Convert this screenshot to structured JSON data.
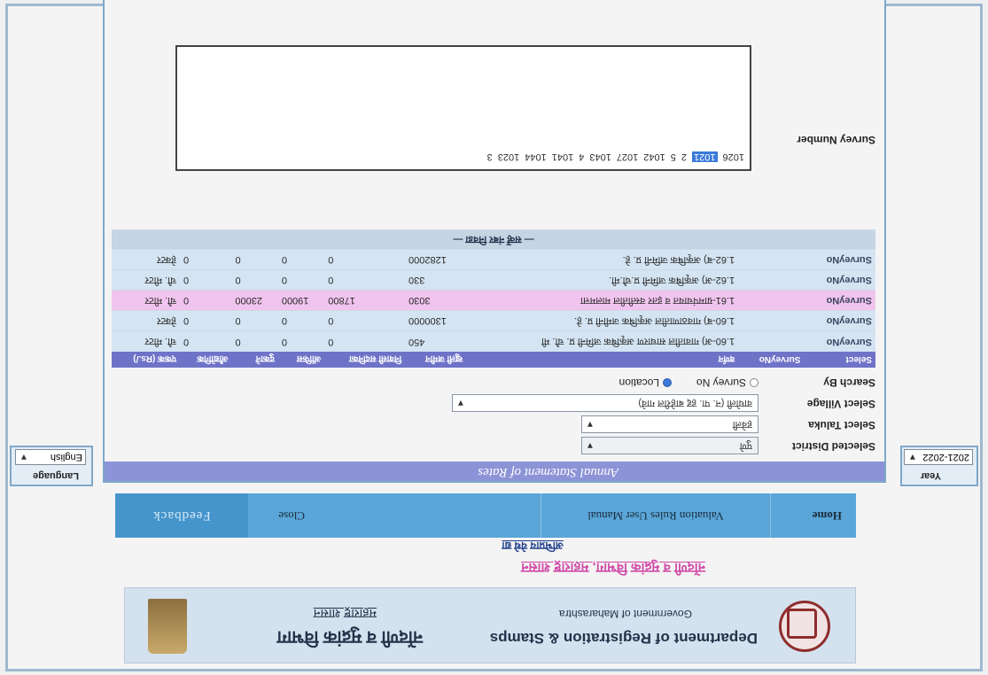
{
  "header": {
    "dept_en": "Department of Registration & Stamps",
    "gov_en": "Government of Maharashtra",
    "dept_mr": "नोंदणी व मुद्रांक विभाग",
    "gov_mr": "महाराष्ट्र शासन",
    "slogan": "नोंदणी व मुद्रांक विभाग, महाराष्ट्र शासन",
    "feedback_link": "अभिप्राय येथे द्या"
  },
  "nav": {
    "home": "Home",
    "valuation": "Valuation Rules   User Manual",
    "close": "Close",
    "feedback": "Feedback"
  },
  "year": {
    "label": "Year",
    "value": "2021-2022"
  },
  "language": {
    "label": "Language",
    "value": "English"
  },
  "panel": {
    "title": "Annual Statement of Rates",
    "district_label": "Selected District",
    "district_value": "पुणे",
    "taluka_label": "Select Taluka",
    "taluka_value": "हवेली",
    "village_label": "Select Village",
    "village_value": "वाघोली (न. पा. हद्द बाहेरील गावे)",
    "search_label": "Search By",
    "search_opt1": "Survey No",
    "search_opt2": "Location"
  },
  "table": {
    "headers": [
      "Select",
      "SurveyNo",
      "वर्णन",
      "खुली जमीन",
      "निवासी सदनिका",
      "ऑफिस",
      "दुकाने",
      "औद्योगिक",
      "एकक (Rs./)"
    ],
    "rows": [
      {
        "sel": "SurveyNo",
        "land": "",
        "desc": "1.60-अ) गावातील साधारण अकृषिक जमिनी प्र. चौ. मी",
        "open": "450",
        "res": "0",
        "off": "0",
        "shop": "0",
        "ind": "0",
        "unit": "चौ. मीटर"
      },
      {
        "sel": "SurveyNo",
        "land": "",
        "desc": "1.60-ब) गावठाणातील अकृषिक जमीनी प्र. हे.",
        "open": "1300000",
        "res": "0",
        "off": "0",
        "shop": "0",
        "ind": "0",
        "unit": "हेक्टर"
      },
      {
        "sel": "SurveyNo",
        "land": "",
        "desc": "1.61-ग्रामपंचायत व इतर वस्तीतील मालमत्ता",
        "open": "3030",
        "res": "17800",
        "off": "19000",
        "shop": "23000",
        "ind": "0",
        "unit": "चौ. मीटर",
        "hl": true
      },
      {
        "sel": "SurveyNo",
        "land": "",
        "desc": "1.62-अ) अकृषिक जमिनी प्र.चौ.मी.",
        "open": "330",
        "res": "0",
        "off": "0",
        "shop": "0",
        "ind": "0",
        "unit": "चौ. मीटर"
      },
      {
        "sel": "SurveyNo",
        "land": "",
        "desc": "1.62-ब) अकृषिक जमिनी प्र. हे.",
        "open": "1282000",
        "res": "0",
        "off": "0",
        "shop": "0",
        "ind": "0",
        "unit": "हेक्टर"
      }
    ],
    "footer": "— सर्व्हे नंबर निवडा —"
  },
  "survey": {
    "label": "Survey Number",
    "numbers": [
      "1026",
      "1021",
      "2",
      "5",
      "1042",
      "1027",
      "1043",
      "4",
      "1041",
      "1044",
      "1023",
      "3"
    ]
  }
}
